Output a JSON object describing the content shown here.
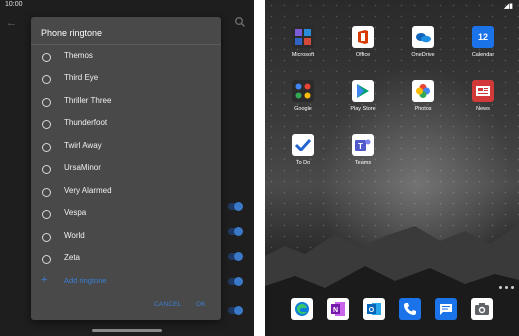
{
  "left_pane": {
    "status_time": "10:00",
    "dialog": {
      "title": "Phone ringtone",
      "ringtones": [
        "Themos",
        "Third Eye",
        "Thriller Three",
        "Thunderfoot",
        "Twirl Away",
        "UrsaMinor",
        "Very Alarmed",
        "Vespa",
        "World",
        "Zeta"
      ],
      "add_label": "Add ringtone",
      "cancel_label": "CANCEL",
      "ok_label": "OK"
    }
  },
  "right_pane": {
    "apps": [
      {
        "label": "Microsoft",
        "icon": "microsoft-folder-icon"
      },
      {
        "label": "Office",
        "icon": "office-icon"
      },
      {
        "label": "OneDrive",
        "icon": "onedrive-icon"
      },
      {
        "label": "Calendar",
        "icon": "calendar-icon",
        "badge": "12"
      },
      {
        "label": "Google",
        "icon": "google-folder-icon"
      },
      {
        "label": "Play Store",
        "icon": "play-store-icon"
      },
      {
        "label": "Photos",
        "icon": "photos-icon"
      },
      {
        "label": "News",
        "icon": "news-icon"
      },
      {
        "label": "To Do",
        "icon": "todo-icon"
      },
      {
        "label": "Teams",
        "icon": "teams-icon"
      }
    ],
    "dock": [
      "edge-icon",
      "onenote-icon",
      "outlook-icon",
      "phone-icon",
      "messages-icon",
      "camera-icon"
    ]
  },
  "colors": {
    "accent": "#3b7fd4",
    "dialog_bg": "#494949",
    "left_bg": "#1e1e1e"
  }
}
